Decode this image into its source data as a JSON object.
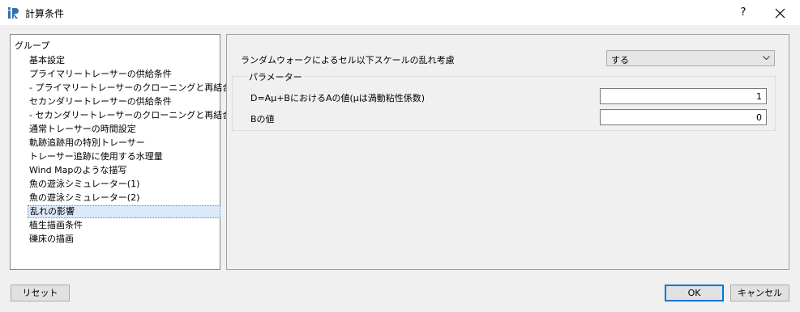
{
  "window": {
    "title": "計算条件",
    "help_label": "?",
    "app_icon": "iric-logo-icon",
    "close_icon": "close-icon"
  },
  "sidebar": {
    "header": "グループ",
    "items": [
      {
        "label": "基本設定"
      },
      {
        "label": "プライマリートレーサーの供給条件"
      },
      {
        "label": "- プライマリートレーサーのクローニングと再結合"
      },
      {
        "label": "セカンダリートレーサーの供給条件"
      },
      {
        "label": "- セカンダリートレーサーのクローニングと再結合"
      },
      {
        "label": "通常トレーサーの時間設定"
      },
      {
        "label": "軌跡追跡用の特別トレーサー"
      },
      {
        "label": "トレーサー追跡に使用する水理量"
      },
      {
        "label": "Wind Mapのような描写"
      },
      {
        "label": "魚の遊泳シミュレーター(1)"
      },
      {
        "label": "魚の遊泳シミュレーター(2)"
      },
      {
        "label": "乱れの影響",
        "selected": true
      },
      {
        "label": "植生描画条件"
      },
      {
        "label": "礫床の描画"
      }
    ]
  },
  "main": {
    "random_walk_label": "ランダムウォークによるセル以下スケールの乱れ考慮",
    "random_walk_value": "する",
    "dropdown_icon": "chevron-down-icon",
    "param_group_title": "パラメーター",
    "param_a_label": "D=Aμ+BにおけるAの値(μは渦動粘性係数)",
    "param_a_value": "1",
    "param_b_label": "Bの値",
    "param_b_value": "0"
  },
  "footer": {
    "reset_label": "リセット",
    "ok_label": "OK",
    "cancel_label": "キャンセル"
  },
  "colors": {
    "selection_bg": "#dce9f8",
    "selection_border": "#5b8dd5",
    "default_button_border": "#0078d7",
    "logo_blue": "#2f6fb7"
  }
}
